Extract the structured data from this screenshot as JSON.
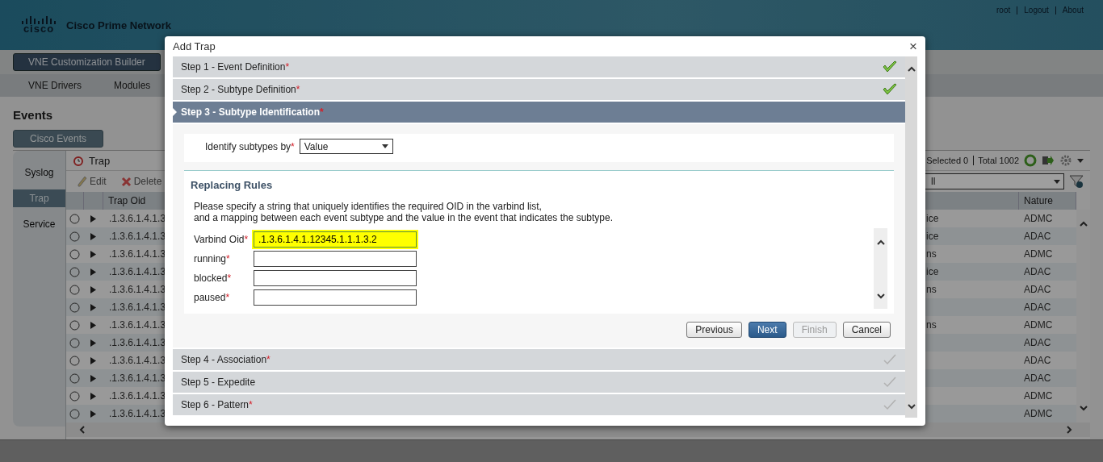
{
  "header": {
    "logo": "cisco",
    "product": "Cisco Prime Network",
    "links": [
      "root",
      "Logout",
      "About"
    ]
  },
  "builder_button": "VNE Customization Builder",
  "nav": [
    {
      "label": "VNE Drivers"
    },
    {
      "label": "Modules"
    }
  ],
  "page_title": "Events",
  "category_button": "Cisco Events",
  "side_tabs": [
    {
      "label": "Syslog",
      "selected": false
    },
    {
      "label": "Trap",
      "selected": true
    },
    {
      "label": "Service",
      "selected": false
    }
  ],
  "panel": {
    "title": "Trap",
    "toolbar": [
      {
        "label": "Edit",
        "kind": "edit"
      },
      {
        "label": "Delete",
        "kind": "delete"
      }
    ],
    "selection": "Selected 0",
    "total": "Total 1002",
    "filter": "ll"
  },
  "table": {
    "columns": [
      "Trap Oid",
      "Nature"
    ],
    "rows": [
      {
        "trap_oid": ".1.3.6.1.4.1.3",
        "column_3": "ice",
        "nature": "ADMC"
      },
      {
        "trap_oid": ".1.3.6.1.4.1.3",
        "column_3": "ice",
        "nature": "ADAC"
      },
      {
        "trap_oid": ".1.3.6.1.4.1.3",
        "column_3": "ns",
        "nature": "ADMC"
      },
      {
        "trap_oid": ".1.3.6.1.4.1.3",
        "column_3": "ice",
        "nature": "ADAC"
      },
      {
        "trap_oid": ".1.3.6.1.4.1.3",
        "column_3": "ns",
        "nature": "ADAC"
      },
      {
        "trap_oid": ".1.3.6.1.4.1.3",
        "nature": "ADAC"
      },
      {
        "trap_oid": ".1.3.6.1.4.1.3",
        "column_3": "ns",
        "nature": "ADMC"
      },
      {
        "trap_oid": ".1.3.6.1.4.1.3",
        "nature": "ADAC"
      },
      {
        "trap_oid": ".1.3.6.1.4.1.3",
        "nature": "ADAC"
      },
      {
        "trap_oid": ".1.3.6.1.4.1.3",
        "nature": "ADAC"
      },
      {
        "trap_oid": ".1.3.6.1.4.1.3",
        "nature": "ADMC"
      },
      {
        "trap_oid": ".1.3.6.1.4.1.3",
        "nature": "ADMC"
      }
    ]
  },
  "dialog": {
    "title": "Add Trap",
    "close": "×",
    "steps": [
      {
        "label": "Step 1 - Event Definition",
        "required_mark": "*",
        "completed": true,
        "expanded": false
      },
      {
        "label": "Step 2 - Subtype Definition",
        "required_mark": "*",
        "completed": true,
        "expanded": false
      },
      {
        "label": "Step 3 - Subtype Identification",
        "required_mark": "*",
        "expanded": true
      },
      {
        "label": "Step 4 - Association",
        "required_mark": "*",
        "completed": false,
        "expanded": false
      },
      {
        "label": "Step 5 - Expedite",
        "completed": false,
        "expanded": false
      },
      {
        "label": "Step 6 - Pattern",
        "required_mark": "*",
        "completed": false,
        "expanded": false
      }
    ],
    "identify": {
      "label": "Identify subtypes by",
      "required_mark": "*",
      "value": "Value"
    },
    "rules": {
      "title": "Replacing Rules",
      "description": [
        "Please specify a string that uniquely identifies the required OID in the varbind list,",
        "and a mapping between each event subtype and the value in the event that indicates the subtype."
      ],
      "fields": [
        {
          "label": "Varbind Oid",
          "required_mark": "*",
          "value": ".1.3.6.1.4.1.12345.1.1.1.3.2",
          "highlighted": true
        },
        {
          "label": "running",
          "required_mark": "*",
          "highlighted": false
        },
        {
          "label": "blocked",
          "required_mark": "*",
          "highlighted": false
        },
        {
          "label": "paused",
          "required_mark": "*",
          "highlighted": false
        }
      ]
    },
    "buttons": [
      {
        "label": "Previous",
        "primary": false,
        "disabled": false
      },
      {
        "label": "Next",
        "primary": true,
        "disabled": false
      },
      {
        "label": "Finish",
        "primary": false,
        "disabled": true
      },
      {
        "label": "Cancel",
        "primary": false,
        "disabled": false
      }
    ]
  }
}
